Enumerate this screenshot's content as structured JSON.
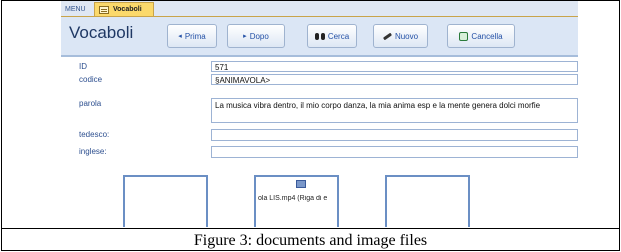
{
  "tabs": {
    "menu": "MENU",
    "vocaboli": "Vocaboli"
  },
  "header": {
    "title": "Vocaboli",
    "buttons": {
      "prima": "Prima",
      "dopo": "Dopo",
      "cerca": "Cerca",
      "nuovo": "Nuovo",
      "cancella": "Cancella"
    }
  },
  "fields": {
    "id": {
      "label": "ID",
      "value": "571"
    },
    "codice": {
      "label": "codice",
      "value": "§ANIMAVOLA>"
    },
    "parola": {
      "label": "parola",
      "value": "La musica vibra dentro, il mio corpo danza, la mia anima esp e la mente genera dolci morfie"
    },
    "tedesco": {
      "label": "tedesco:",
      "value": ""
    },
    "inglese": {
      "label": "inglese:",
      "value": ""
    }
  },
  "attachments": {
    "middle_file": "ola LIS.mp4 (Riga di e"
  },
  "caption": "Figure 3: documents and image files",
  "icons": {
    "tab": "form-icon",
    "prev": "triangle-left-icon",
    "next": "triangle-right-icon",
    "search": "binoculars-icon",
    "new": "pencil-icon",
    "delete": "delete-record-icon",
    "attachment": "video-file-icon"
  }
}
